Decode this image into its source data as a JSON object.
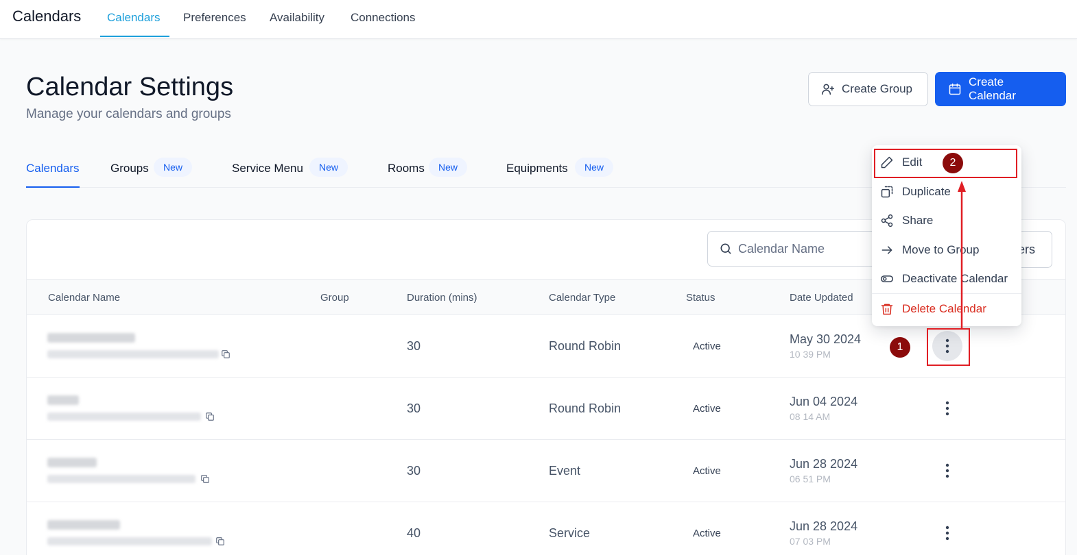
{
  "app": {
    "title": "Calendars"
  },
  "top_nav": [
    {
      "label": "Calendars",
      "active": true
    },
    {
      "label": "Preferences"
    },
    {
      "label": "Availability"
    },
    {
      "label": "Connections"
    }
  ],
  "header": {
    "title": "Calendar Settings",
    "subtitle": "Manage your calendars and groups",
    "create_group_label": "Create Group",
    "create_calendar_label": "Create Calendar"
  },
  "sub_tabs": [
    {
      "label": "Calendars",
      "active": true
    },
    {
      "label": "Groups",
      "badge": "New"
    },
    {
      "label": "Service Menu",
      "badge": "New"
    },
    {
      "label": "Rooms",
      "badge": "New"
    },
    {
      "label": "Equipments",
      "badge": "New"
    }
  ],
  "toolbar": {
    "search_placeholder": "Calendar Name",
    "filters_label": "ers"
  },
  "table": {
    "columns": [
      "Calendar Name",
      "Group",
      "Duration (mins)",
      "Calendar Type",
      "Status",
      "Date Updated"
    ],
    "rows": [
      {
        "duration": "30",
        "type": "Round Robin",
        "status": "Active",
        "date": "May 30 2024",
        "time": "10 39 PM"
      },
      {
        "duration": "30",
        "type": "Round Robin",
        "status": "Active",
        "date": "Jun 04 2024",
        "time": "08 14 AM"
      },
      {
        "duration": "30",
        "type": "Event",
        "status": "Active",
        "date": "Jun 28 2024",
        "time": "06 51 PM"
      },
      {
        "duration": "40",
        "type": "Service",
        "status": "Active",
        "date": "Jun 28 2024",
        "time": "07 03 PM"
      }
    ]
  },
  "menu": {
    "items": [
      {
        "label": "Edit",
        "icon": "pencil-icon"
      },
      {
        "label": "Duplicate",
        "icon": "duplicate-icon"
      },
      {
        "label": "Share",
        "icon": "share-icon"
      },
      {
        "label": "Move to Group",
        "icon": "arrow-right-icon"
      },
      {
        "label": "Deactivate Calendar",
        "icon": "toggle-icon"
      },
      {
        "label": "Delete Calendar",
        "icon": "trash-icon",
        "danger": true
      }
    ]
  },
  "annotations": {
    "step1": "1",
    "step2": "2",
    "highlight_color": "#e01e24",
    "step_color": "#8b0b0b"
  },
  "colors": {
    "primary": "#155eef",
    "top_nav_active": "#1ea0db",
    "danger": "#d92d20"
  }
}
